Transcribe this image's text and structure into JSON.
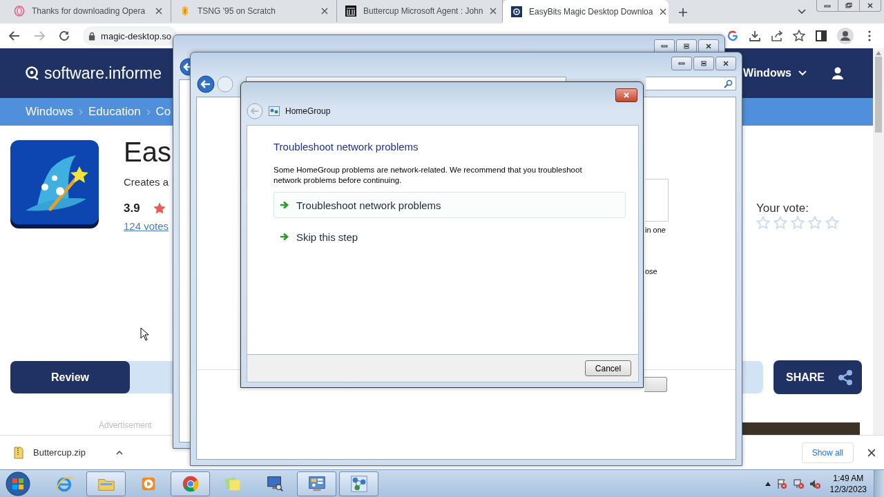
{
  "browser": {
    "tabs": [
      {
        "title": "Thanks for downloading Opera",
        "kind": "opera",
        "selected": false
      },
      {
        "title": "TSNG '95 on Scratch",
        "kind": "scratch",
        "selected": false
      },
      {
        "title": "Buttercup Microsoft Agent : John",
        "kind": "archive",
        "selected": false
      },
      {
        "title": "EasyBits Magic Desktop Downloa",
        "kind": "site",
        "selected": true
      }
    ],
    "url": "magic-desktop.so"
  },
  "site": {
    "logo": "software.informe",
    "nav": "Windows",
    "breadcrumbs": [
      "Windows",
      "Education",
      "Co"
    ],
    "app": {
      "title": "Eas",
      "subtitle": "Creates a",
      "rating": "3.9",
      "votes": "124 votes"
    },
    "your_vote": {
      "label": "Your vote:",
      "stars": 0
    },
    "review": "Review",
    "share": "SHARE",
    "advertisement": "Advertisement"
  },
  "downloads": {
    "file": "Buttercup.zip",
    "show_all": "Show all"
  },
  "control_panel": {
    "fragments": [
      "in one",
      "ose"
    ]
  },
  "dialog": {
    "location": "HomeGroup",
    "heading": "Troubleshoot network problems",
    "body": "Some HomeGroup problems are network-related. We recommend that you troubleshoot network problems before continuing.",
    "options": [
      {
        "label": "Troubleshoot network problems",
        "selected": true
      },
      {
        "label": "Skip this step",
        "selected": false
      }
    ],
    "cancel": "Cancel"
  },
  "taskbar": {
    "apps": [
      {
        "kind": "ie",
        "running": false
      },
      {
        "kind": "explorer",
        "running": true
      },
      {
        "kind": "media",
        "running": false
      },
      {
        "kind": "chrome",
        "running": true
      },
      {
        "kind": "notes",
        "running": false
      },
      {
        "kind": "display",
        "running": false
      },
      {
        "kind": "control",
        "running": true
      },
      {
        "kind": "network",
        "running": true
      }
    ],
    "time": "1:49 AM",
    "date": "12/3/2023"
  }
}
